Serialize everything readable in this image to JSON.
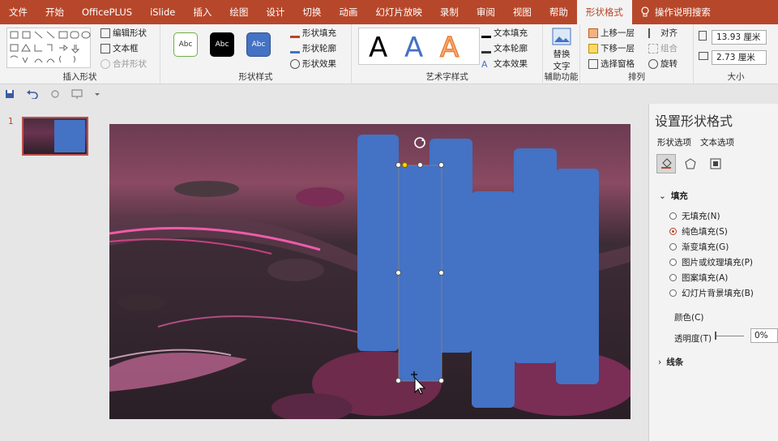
{
  "menu": {
    "tabs": [
      "文件",
      "开始",
      "OfficePLUS",
      "iSlide",
      "插入",
      "绘图",
      "设计",
      "切换",
      "动画",
      "幻灯片放映",
      "录制",
      "审阅",
      "视图",
      "帮助",
      "形状格式"
    ],
    "active_tab": "形状格式",
    "help_label": "操作说明搜索"
  },
  "ribbon": {
    "insert_shapes": {
      "label": "插入形状",
      "edit_shape": "编辑形状",
      "text_box": "文本框",
      "merge_shapes": "合并形状"
    },
    "shape_styles": {
      "label": "形状样式",
      "preset": "Abc",
      "fill": "形状填充",
      "outline": "形状轮廓",
      "effects": "形状效果"
    },
    "wordart": {
      "label": "艺术字样式",
      "letter": "A",
      "text_fill": "文本填充",
      "text_outline": "文本轮廓",
      "text_effects": "文本效果"
    },
    "accessibility": {
      "label": "辅助功能",
      "alt_text_1": "替换",
      "alt_text_2": "文字"
    },
    "arrange": {
      "label": "排列",
      "bring_forward": "上移一层",
      "send_backward": "下移一层",
      "selection_pane": "选择窗格",
      "align": "对齐",
      "group": "组合",
      "rotate": "旋转"
    },
    "size": {
      "label": "大小",
      "height": "13.93 厘米",
      "width": "2.73 厘米"
    }
  },
  "thumbnail": {
    "number": "1"
  },
  "pane": {
    "title": "设置形状格式",
    "tabs": [
      "形状选项",
      "文本选项"
    ],
    "section_fill": "填充",
    "fill_options": [
      "无填充(N)",
      "纯色填充(S)",
      "渐变填充(G)",
      "图片或纹理填充(P)",
      "图案填充(A)",
      "幻灯片背景填充(B)"
    ],
    "selected_fill": "纯色填充(S)",
    "color_label": "颜色(C)",
    "transparency_label": "透明度(T)",
    "transparency_value": "0%",
    "section_line": "线条"
  },
  "colors": {
    "accent": "#b7472a",
    "shape_fill": "#4472c4"
  }
}
